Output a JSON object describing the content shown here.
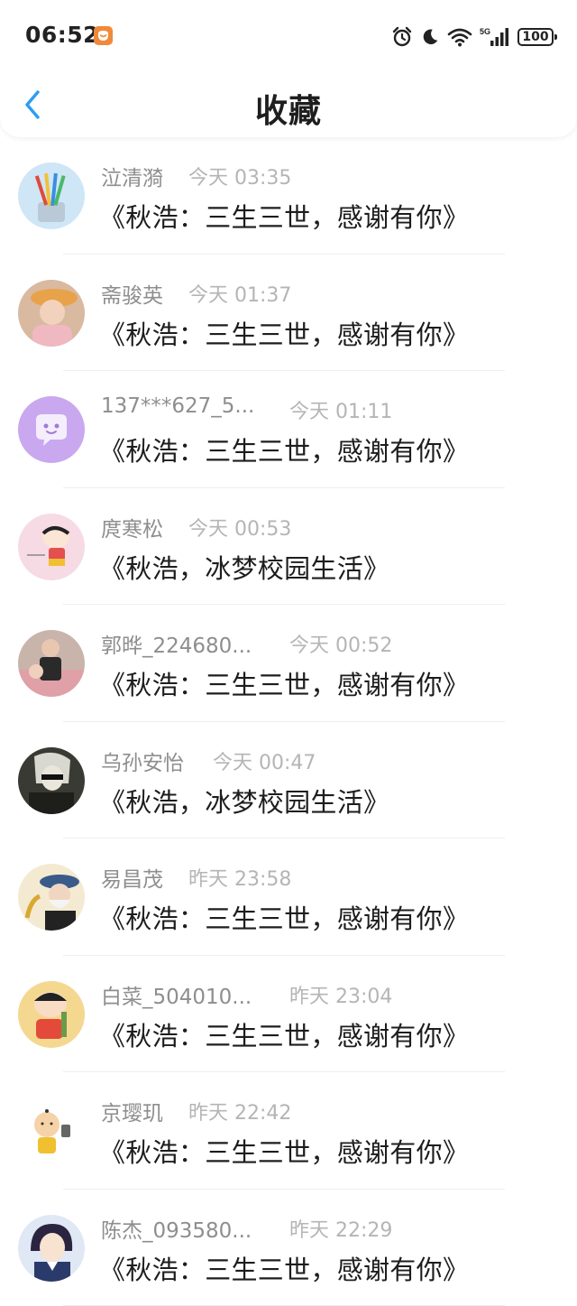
{
  "status_bar": {
    "time": "06:52",
    "battery": "100",
    "network": "5G"
  },
  "header": {
    "title": "收藏"
  },
  "colors": {
    "accent": "#2a9df4",
    "badge": "#f08a3a"
  },
  "items": [
    {
      "name": "泣清漪",
      "time": "今天 03:35",
      "message": "《秋浩：三生三世，感谢有你》"
    },
    {
      "name": "斋骏英",
      "time": "今天 01:37",
      "message": "《秋浩：三生三世，感谢有你》"
    },
    {
      "name": "137***627_5...",
      "time": "今天 01:11",
      "message": "《秋浩：三生三世，感谢有你》"
    },
    {
      "name": "庹寒松",
      "time": "今天 00:53",
      "message": "《秋浩，冰梦校园生活》"
    },
    {
      "name": "郭晔_224680...",
      "time": "今天 00:52",
      "message": "《秋浩：三生三世，感谢有你》"
    },
    {
      "name": "乌孙安怡",
      "time": "今天 00:47",
      "message": "《秋浩，冰梦校园生活》"
    },
    {
      "name": "易昌茂",
      "time": "昨天 23:58",
      "message": "《秋浩：三生三世，感谢有你》"
    },
    {
      "name": "白菜_504010...",
      "time": "昨天 23:04",
      "message": "《秋浩：三生三世，感谢有你》"
    },
    {
      "name": "京璎玑",
      "time": "昨天 22:42",
      "message": "《秋浩：三生三世，感谢有你》"
    },
    {
      "name": "陈杰_093580...",
      "time": "昨天 22:29",
      "message": "《秋浩：三生三世，感谢有你》"
    }
  ]
}
